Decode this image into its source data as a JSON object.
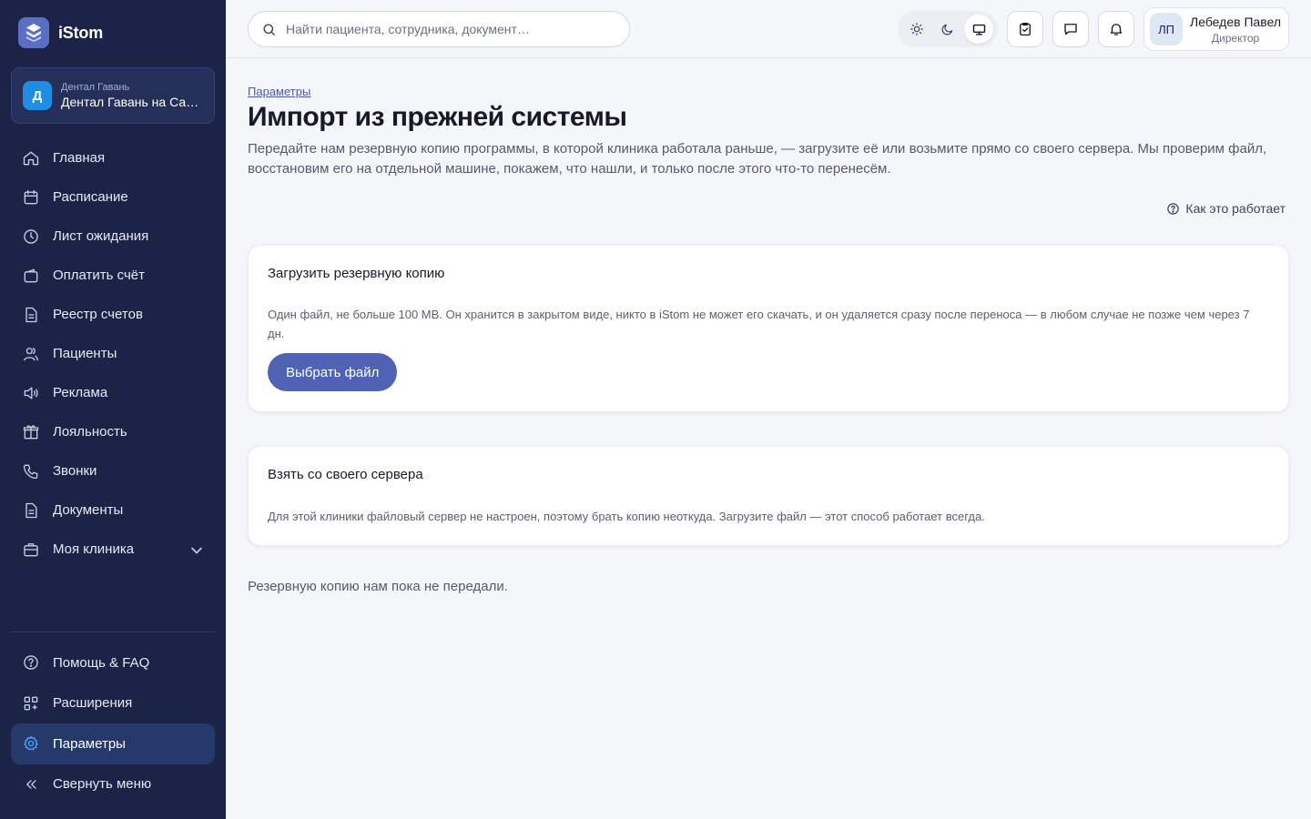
{
  "app": {
    "name": "iStom"
  },
  "clinic": {
    "avatar": "Д",
    "org": "Дентал Гавань",
    "name": "Дентал Гавань на Садовой"
  },
  "sidebar": {
    "items": [
      {
        "label": "Главная",
        "icon": "home-icon"
      },
      {
        "label": "Расписание",
        "icon": "calendar-icon"
      },
      {
        "label": "Лист ожидания",
        "icon": "clock-icon"
      },
      {
        "label": "Оплатить счёт",
        "icon": "wallet-icon"
      },
      {
        "label": "Реестр счетов",
        "icon": "document-icon"
      },
      {
        "label": "Пациенты",
        "icon": "users-icon"
      },
      {
        "label": "Реклама",
        "icon": "megaphone-icon"
      },
      {
        "label": "Лояльность",
        "icon": "gift-icon"
      },
      {
        "label": "Звонки",
        "icon": "phone-icon"
      },
      {
        "label": "Документы",
        "icon": "document-icon"
      },
      {
        "label": "Моя клиника",
        "icon": "briefcase-icon"
      }
    ],
    "bottom": [
      {
        "label": "Помощь & FAQ",
        "icon": "help-icon"
      },
      {
        "label": "Расширения",
        "icon": "puzzle-icon"
      },
      {
        "label": "Параметры",
        "icon": "gear-icon",
        "active": true
      },
      {
        "label": "Свернуть меню",
        "icon": "collapse-icon"
      }
    ]
  },
  "header": {
    "search_placeholder": "Найти пациента, сотрудника, документ…",
    "theme_options": [
      "light",
      "dark",
      "system"
    ],
    "theme_selected": "system",
    "user": {
      "initials": "ЛП",
      "name": "Лебедев Павел",
      "role": "Директор"
    }
  },
  "main": {
    "breadcrumb": "Параметры",
    "title": "Импорт из прежней системы",
    "description": "Передайте нам резервную копию программы, в которой клиника работала раньше, — загрузите её или возьмите прямо со своего сервера. Мы проверим файл, восстановим его на отдельной машине, покажем, что нашли, и только после этого что-то перенесём.",
    "how_link": "Как это работает",
    "upload_card": {
      "title": "Загрузить резервную копию",
      "text": "Один файл, не больше 100 МВ. Он хранится в закрытом виде, никто в iStom не может его скачать, и он удаляется сразу после переноса — в любом случае не позже чем через 7 дн.",
      "button": "Выбрать файл"
    },
    "server_card": {
      "title": "Взять со своего сервера",
      "text": "Для этой клиники файловый сервер не настроен, поэтому брать копию неоткуда. Загрузите файл — этот способ работает всегда."
    },
    "status": "Резервную копию нам пока не передали."
  },
  "colors": {
    "sidebar_bg": "#1b2447",
    "accent": "#5062b4",
    "active_item": "#253a6b",
    "clinic_avatar": "#1e8fe0"
  }
}
